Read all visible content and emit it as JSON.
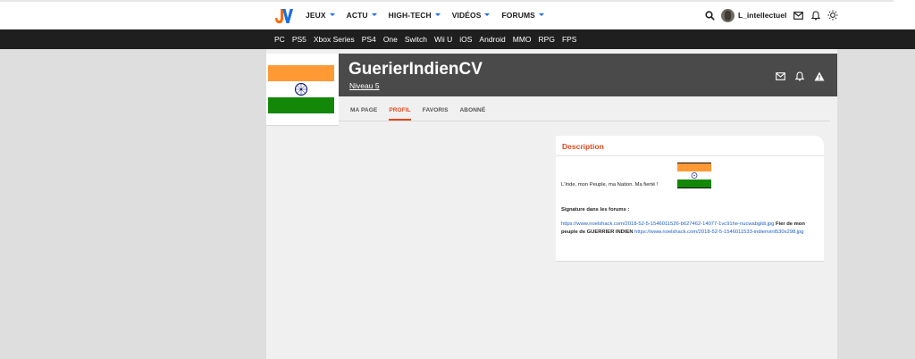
{
  "header": {
    "logo_text": "JV",
    "nav": [
      {
        "label": "JEUX"
      },
      {
        "label": "ACTU"
      },
      {
        "label": "HIGH-TECH"
      },
      {
        "label": "VIDÉOS"
      },
      {
        "label": "FORUMS"
      }
    ],
    "username": "L_intellectuel",
    "icons": [
      "search-icon",
      "avatar",
      "mail-icon",
      "bell-icon",
      "sun-icon"
    ]
  },
  "platforms": [
    "PC",
    "PS5",
    "Xbox Series",
    "PS4",
    "One",
    "Switch",
    "Wii U",
    "iOS",
    "Android",
    "MMO",
    "RPG",
    "FPS"
  ],
  "profile": {
    "name": "GuerierIndienCV",
    "level": "Niveau 5",
    "tabs": [
      "MA PAGE",
      "PROFIL",
      "FAVORIS",
      "ABONNÉ"
    ],
    "active_tab": "PROFIL",
    "actions": [
      "mail-icon",
      "bell-icon",
      "warning-icon"
    ]
  },
  "description": {
    "title": "Description",
    "text": "L'Inde, mon Peuple, ma Nation. Ma fierté !",
    "signature_label": "Signature dans les forums :",
    "signature_link1": "https://www.noelshack.com/2018-52-5-1546011526-b627462-14077-1vc91he-nucwabgldi.jpg",
    "signature_text": "Fier de mon peuple de GUERRIER INDIEN",
    "signature_link2": "https://www.noelshack.com/2018-52-5-1546011533-indienviril530x298.jpg"
  },
  "colors": {
    "accent": "#e2481d",
    "nav_caret": "#1b6fe0",
    "header_bg": "#4a4a4a",
    "platform_bar": "#1f1f1f",
    "link": "#1a5fc8"
  }
}
